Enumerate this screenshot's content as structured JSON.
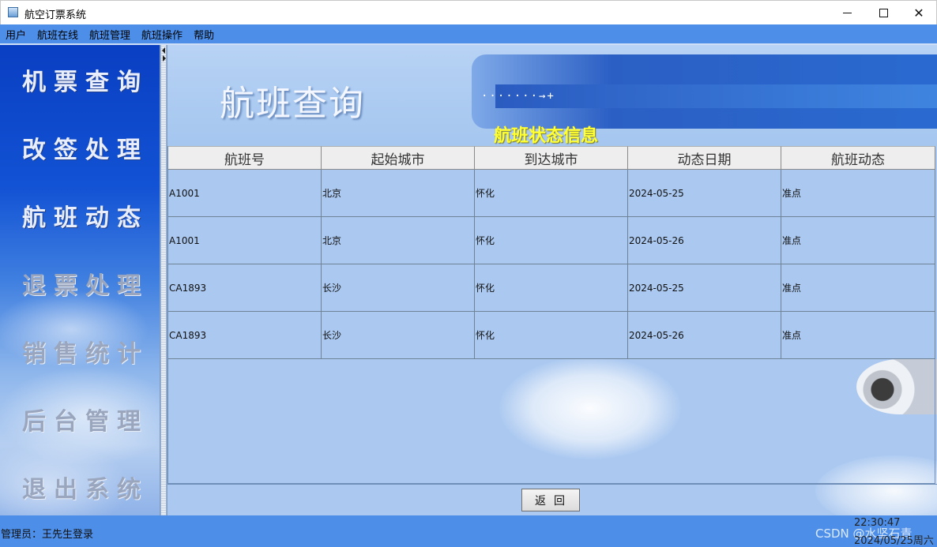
{
  "window": {
    "title": "航空订票系统",
    "controls": {
      "minimize": "",
      "maximize": "",
      "close": "✕"
    }
  },
  "menubar": {
    "items": [
      {
        "label": "用户"
      },
      {
        "label": "航班在线"
      },
      {
        "label": "航班管理"
      },
      {
        "label": "航班操作"
      },
      {
        "label": "帮助"
      }
    ]
  },
  "sidebar": {
    "items": [
      {
        "label": "机票查询"
      },
      {
        "label": "改签处理"
      },
      {
        "label": "航班动态"
      },
      {
        "label": "退票处理"
      },
      {
        "label": "销售统计"
      },
      {
        "label": "后台管理"
      },
      {
        "label": "退出系统"
      }
    ]
  },
  "banner": {
    "title": "航班查询",
    "section_title": "航班状态信息",
    "dots": "·······→+"
  },
  "table": {
    "headers": [
      "航班号",
      "起始城市",
      "到达城市",
      "动态日期",
      "航班动态"
    ],
    "rows": [
      [
        "A1001",
        "北京",
        "怀化",
        "2024-05-25",
        "准点"
      ],
      [
        "A1001",
        "北京",
        "怀化",
        "2024-05-26",
        "准点"
      ],
      [
        "CA1893",
        "长沙",
        "怀化",
        "2024-05-25",
        "准点"
      ],
      [
        "CA1893",
        "长沙",
        "怀化",
        "2024-05-26",
        "准点"
      ]
    ]
  },
  "buttons": {
    "back": "返回"
  },
  "statusbar": {
    "admin": "管理员：王先生登录",
    "time": "22:30:47",
    "date": "2024/05/25周六",
    "watermark": "CSDN @水坚石青"
  }
}
